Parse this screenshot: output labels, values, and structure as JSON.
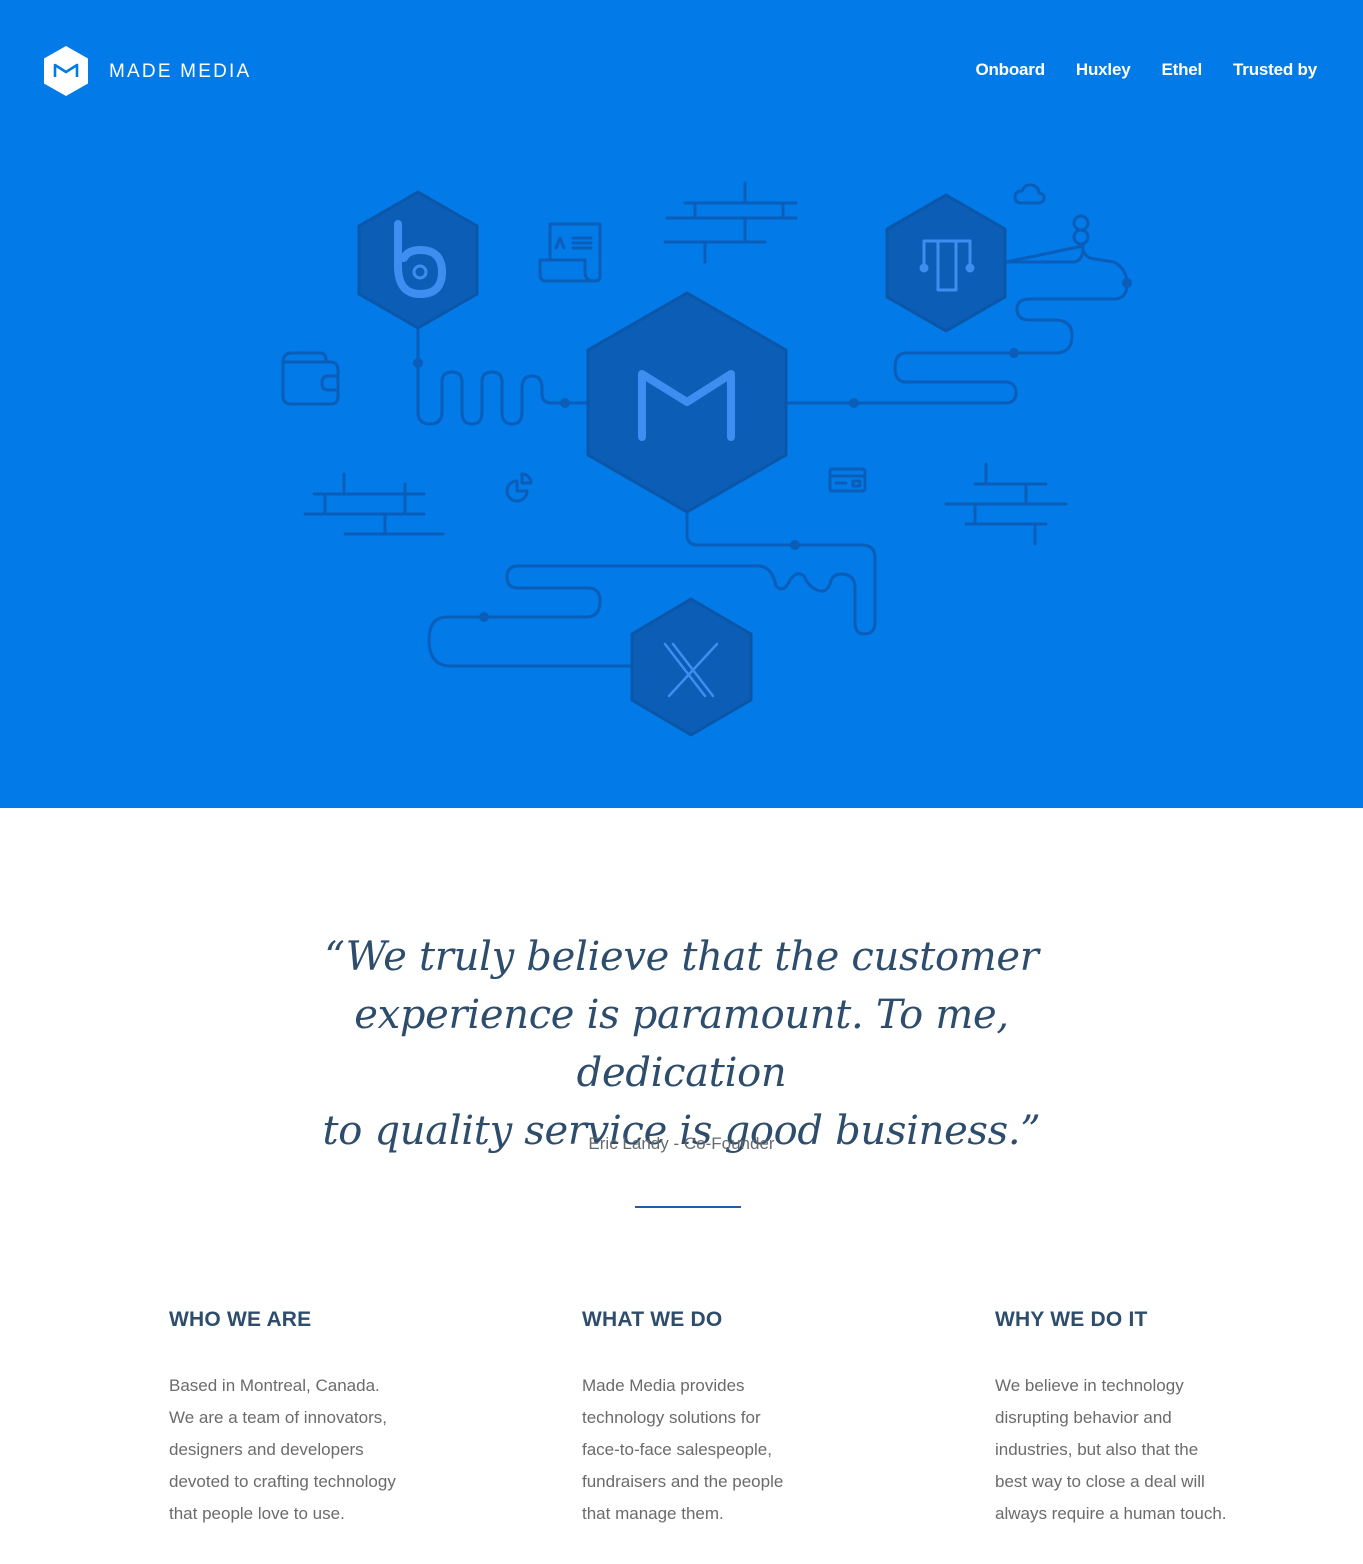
{
  "header": {
    "brand": "MADE MEDIA",
    "nav": [
      "Onboard",
      "Huxley",
      "Ethel",
      "Trusted by"
    ]
  },
  "colors": {
    "hero_background": "#027be8",
    "illustration_stroke": "#0a5db8",
    "hexagon_fill": "#0b5db5",
    "heading": "#2e4d6c",
    "body_text": "#6b6b6b",
    "divider": "#1f5ea6"
  },
  "illustration": {
    "icons": [
      "made-media-hexagon-icon",
      "b-app-hexagon-icon",
      "t-app-hexagon-icon",
      "x-app-hexagon-icon",
      "document-icon",
      "wallet-icon",
      "pie-chart-icon",
      "credit-card-icon",
      "cloud-icon",
      "balloon-icon",
      "brick-lines-icon"
    ]
  },
  "quote": {
    "text": "“We truly believe that the customer experience is paramount. To me, dedication to quality service is good business.”",
    "lines": [
      "“We truly believe that the customer",
      "experience is paramount. To me, dedication",
      "to quality service is good business.”"
    ],
    "author": "Eric Landy - Co-Founder"
  },
  "sections": [
    {
      "title": "WHO WE ARE",
      "lines": [
        "Based in Montreal, Canada.",
        "We are a team of innovators,",
        "designers and developers",
        "devoted to crafting technology",
        "that people love to use."
      ]
    },
    {
      "title": "WHAT WE DO",
      "lines": [
        "Made Media provides",
        "technology solutions for",
        "face-to-face salespeople,",
        "fundraisers and the people",
        "that manage them."
      ]
    },
    {
      "title": "WHY WE DO IT",
      "lines": [
        "We believe in technology",
        "disrupting behavior and",
        "industries, but also that the",
        "best way to close a deal will",
        "always require a human touch."
      ]
    }
  ]
}
